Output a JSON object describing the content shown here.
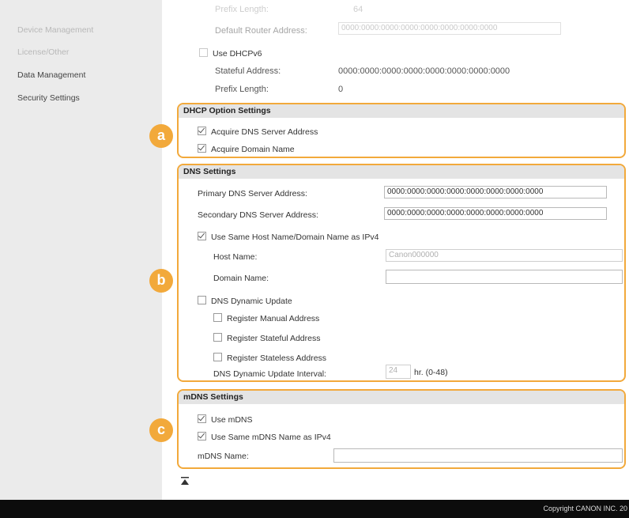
{
  "sidebar": {
    "items": [
      {
        "label": "Device Management",
        "faint": true
      },
      {
        "label": "License/Other",
        "faint": true
      },
      {
        "label": "Data Management",
        "faint": false
      },
      {
        "label": "Security Settings",
        "faint": false
      }
    ]
  },
  "top_block": {
    "prefix_length_label": "Prefix Length:",
    "prefix_length_value": "64",
    "default_router_label": "Default Router Address:",
    "default_router_value": "0000:0000:0000:0000:0000:0000:0000:0000",
    "use_dhcpv6_label": "Use DHCPv6",
    "stateful_address_label": "Stateful Address:",
    "stateful_address_value": "0000:0000:0000:0000:0000:0000:0000:0000",
    "prefix_length2_label": "Prefix Length:",
    "prefix_length2_value": "0"
  },
  "dhcp_option": {
    "badge": "a",
    "title": "DHCP Option Settings",
    "acquire_dns_label": "Acquire DNS Server Address",
    "acquire_domain_label": "Acquire Domain Name"
  },
  "dns": {
    "badge": "b",
    "title": "DNS Settings",
    "primary_label": "Primary DNS Server Address:",
    "primary_value": "0000:0000:0000:0000:0000:0000:0000:0000",
    "secondary_label": "Secondary DNS Server Address:",
    "secondary_value": "0000:0000:0000:0000:0000:0000:0000:0000",
    "same_host_label": "Use Same Host Name/Domain Name as IPv4",
    "host_name_label": "Host Name:",
    "host_name_value": "Canon000000",
    "domain_name_label": "Domain Name:",
    "domain_name_value": "",
    "dynamic_update_label": "DNS Dynamic Update",
    "register_manual_label": "Register Manual Address",
    "register_stateful_label": "Register Stateful Address",
    "register_stateless_label": "Register Stateless Address",
    "interval_label": "DNS Dynamic Update Interval:",
    "interval_value": "24",
    "interval_unit": "hr. (0-48)"
  },
  "mdns": {
    "badge": "c",
    "title": "mDNS Settings",
    "use_mdns_label": "Use mDNS",
    "same_name_label": "Use Same mDNS Name as IPv4",
    "mdns_name_label": "mDNS Name:",
    "mdns_name_value": ""
  },
  "footer": {
    "copyright": "Copyright CANON INC. 20"
  },
  "colors": {
    "accent": "#f2a93b",
    "sidebar_bg": "#ebebeb",
    "footer_bg": "#0c0c0c"
  }
}
